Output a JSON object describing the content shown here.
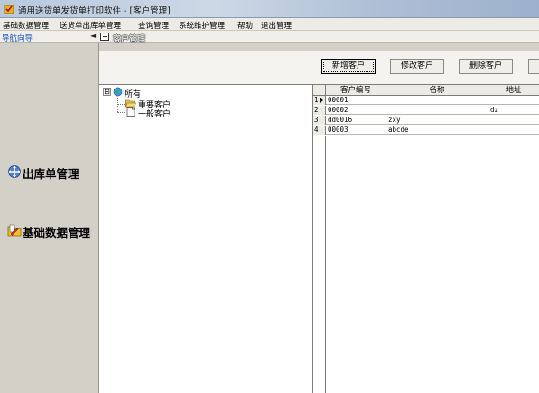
{
  "window": {
    "title": "通用送货单发货单打印软件  - [客户管理]"
  },
  "menu": {
    "items": [
      "基础数据管理",
      "送货单出库单管理",
      "查询管理",
      "系统维护管理",
      "帮助",
      "退出管理"
    ]
  },
  "nav": {
    "title": "导航向导",
    "collapse_glyph": "◄",
    "tab_label": "客户管理"
  },
  "sidebar": {
    "items": [
      {
        "label": "出库单管理",
        "icon": "arrows-icon"
      },
      {
        "label": "基础数据管理",
        "icon": "folder-pen-icon"
      }
    ]
  },
  "toolbar": {
    "buttons": [
      "新增客户",
      "修改客户",
      "删除客户"
    ]
  },
  "tree": {
    "root": {
      "label": "所有",
      "expander": "⊟"
    },
    "children": [
      {
        "label": "重要客户",
        "icon": "folder-open-icon"
      },
      {
        "label": "一般客户",
        "icon": "page-icon"
      }
    ]
  },
  "grid": {
    "columns": [
      "",
      "客户编号",
      "名称",
      "地址"
    ],
    "rows": [
      {
        "idx": "1",
        "code": "00001",
        "name": "",
        "addr": ""
      },
      {
        "idx": "2",
        "code": "00002",
        "name": "",
        "addr": "dz"
      },
      {
        "idx": "3",
        "code": "dd0016",
        "name": "zxy",
        "addr": ""
      },
      {
        "idx": "4",
        "code": "00003",
        "name": "abcde",
        "addr": ""
      }
    ]
  },
  "colors": {
    "nav_title": "#1f57c8",
    "background": "#d4d0c8"
  }
}
